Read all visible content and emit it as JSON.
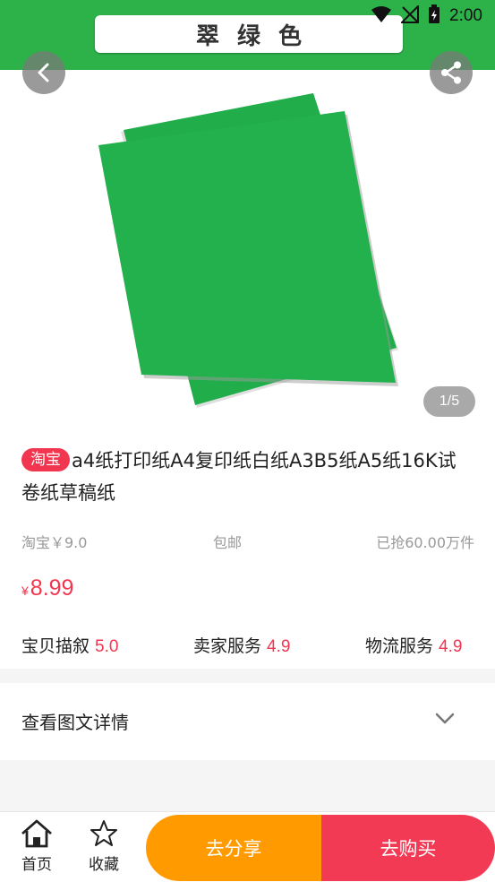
{
  "status_bar": {
    "time": "2:00"
  },
  "product_image": {
    "banner_text": "翠绿色",
    "page_indicator": "1/5",
    "paper_color": "#22b14c"
  },
  "product": {
    "source_badge": "淘宝",
    "title": "a4纸打印纸A4复印纸白纸A3B5纸A5纸16K试卷纸草稿纸",
    "original_price": "淘宝￥9.0",
    "shipping": "包邮",
    "sold": "已抢60.00万件",
    "price_symbol": "¥",
    "price": "8.99"
  },
  "ratings": [
    {
      "label": "宝贝描叙",
      "value": "5.0"
    },
    {
      "label": "卖家服务",
      "value": "4.9"
    },
    {
      "label": "物流服务",
      "value": "4.9"
    }
  ],
  "details": {
    "label": "查看图文详情"
  },
  "bottom_bar": {
    "home_label": "首页",
    "favorite_label": "收藏",
    "share_label": "去分享",
    "buy_label": "去购买"
  },
  "colors": {
    "accent_red": "#f2364f",
    "share_orange": "#ff9a00",
    "header_green": "#2db24a"
  }
}
